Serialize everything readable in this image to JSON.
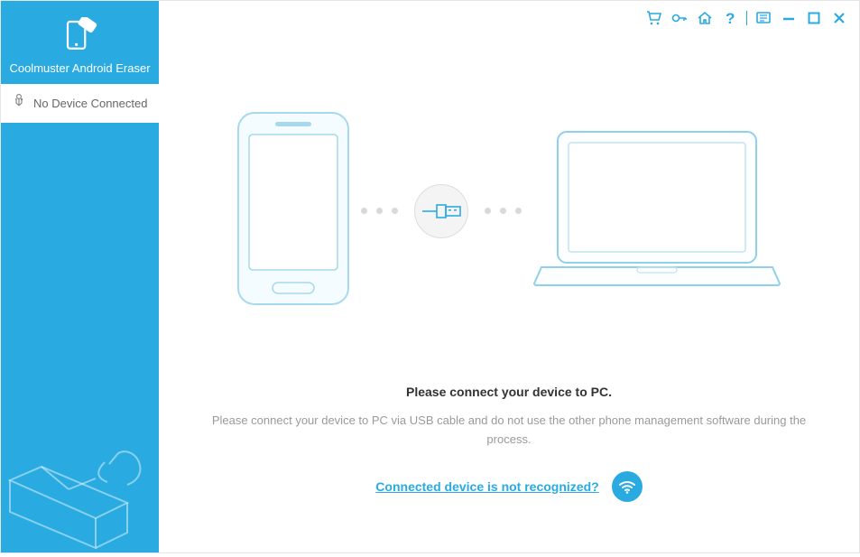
{
  "brand": {
    "title": "Coolmuster Android Eraser"
  },
  "sidebar": {
    "status": "No Device Connected"
  },
  "main": {
    "heading": "Please connect your device to PC.",
    "subtext": "Please connect your device to PC via USB cable and do not use the other phone management software during the process.",
    "help_link": "Connected device is not recognized?"
  },
  "icons": {
    "cart": "cart-icon",
    "key": "key-icon",
    "home": "home-icon",
    "help": "help-icon",
    "feedback": "feedback-icon",
    "minimize": "minimize-icon",
    "maximize": "maximize-icon",
    "close": "close-icon",
    "usb": "usb-icon",
    "wifi": "wifi-icon"
  },
  "colors": {
    "accent": "#29abe2",
    "muted": "#9a9a9a"
  }
}
